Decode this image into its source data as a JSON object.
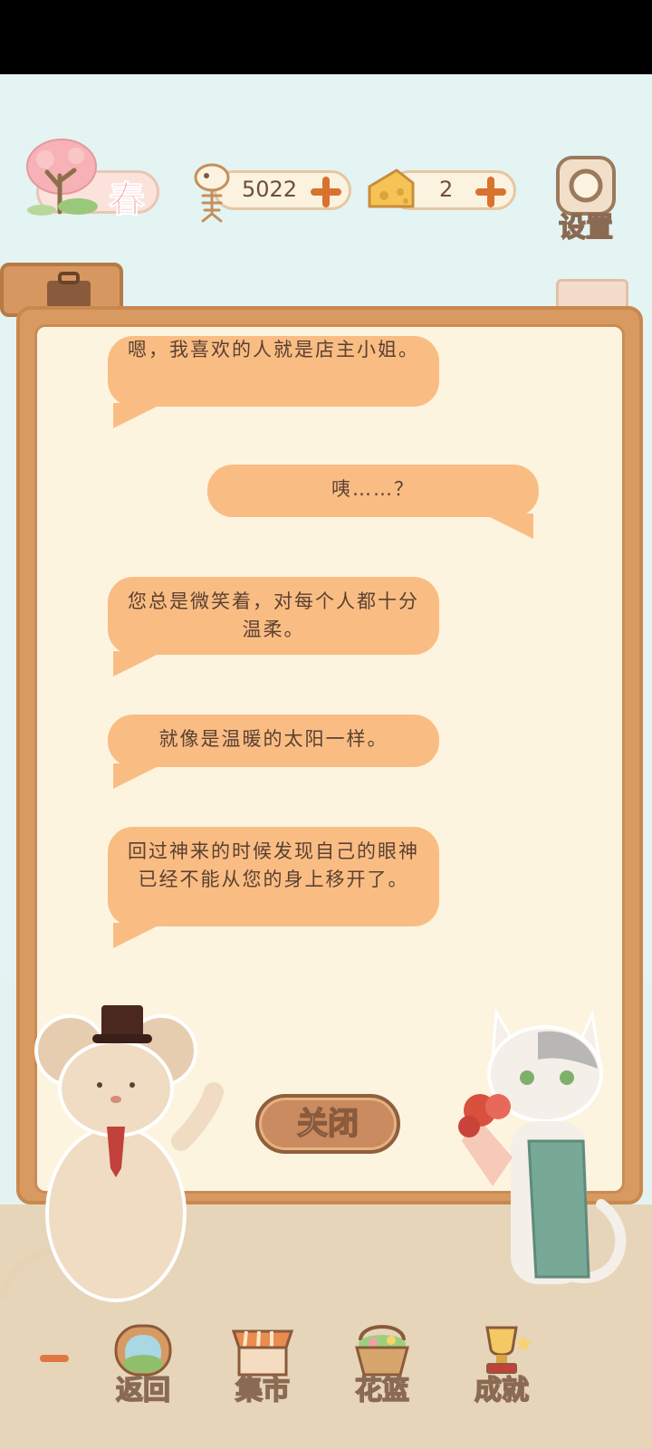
{
  "top_bar": {
    "season_label": "春",
    "fish_amount": "5022",
    "cheese_amount": "2",
    "settings_label": "设置"
  },
  "dialog": {
    "messages": [
      {
        "speaker": "left",
        "text": "嗯，我喜欢的人就是店主小姐。"
      },
      {
        "speaker": "right",
        "text": "咦……？"
      },
      {
        "speaker": "left",
        "text": "您总是微笑着，对每个人都十分温柔。"
      },
      {
        "speaker": "left",
        "text": "就像是温暖的太阳一样。"
      },
      {
        "speaker": "left",
        "text": "回过神来的时候发现自己的眼神已经不能从您的身上移开了。"
      }
    ],
    "close_label": "关闭"
  },
  "bottom_nav": {
    "items": [
      {
        "label": "返回",
        "icon": "window-icon"
      },
      {
        "label": "集市",
        "icon": "market-stall-icon"
      },
      {
        "label": "花篮",
        "icon": "flower-basket-icon"
      },
      {
        "label": "成就",
        "icon": "trophy-icon"
      }
    ]
  },
  "colors": {
    "sky": "#e3f4f3",
    "frame": "#d99a62",
    "paper": "#fdf4e0",
    "bubble": "#f9bd84",
    "text": "#5b4030",
    "accent_plus": "#d9722e"
  }
}
